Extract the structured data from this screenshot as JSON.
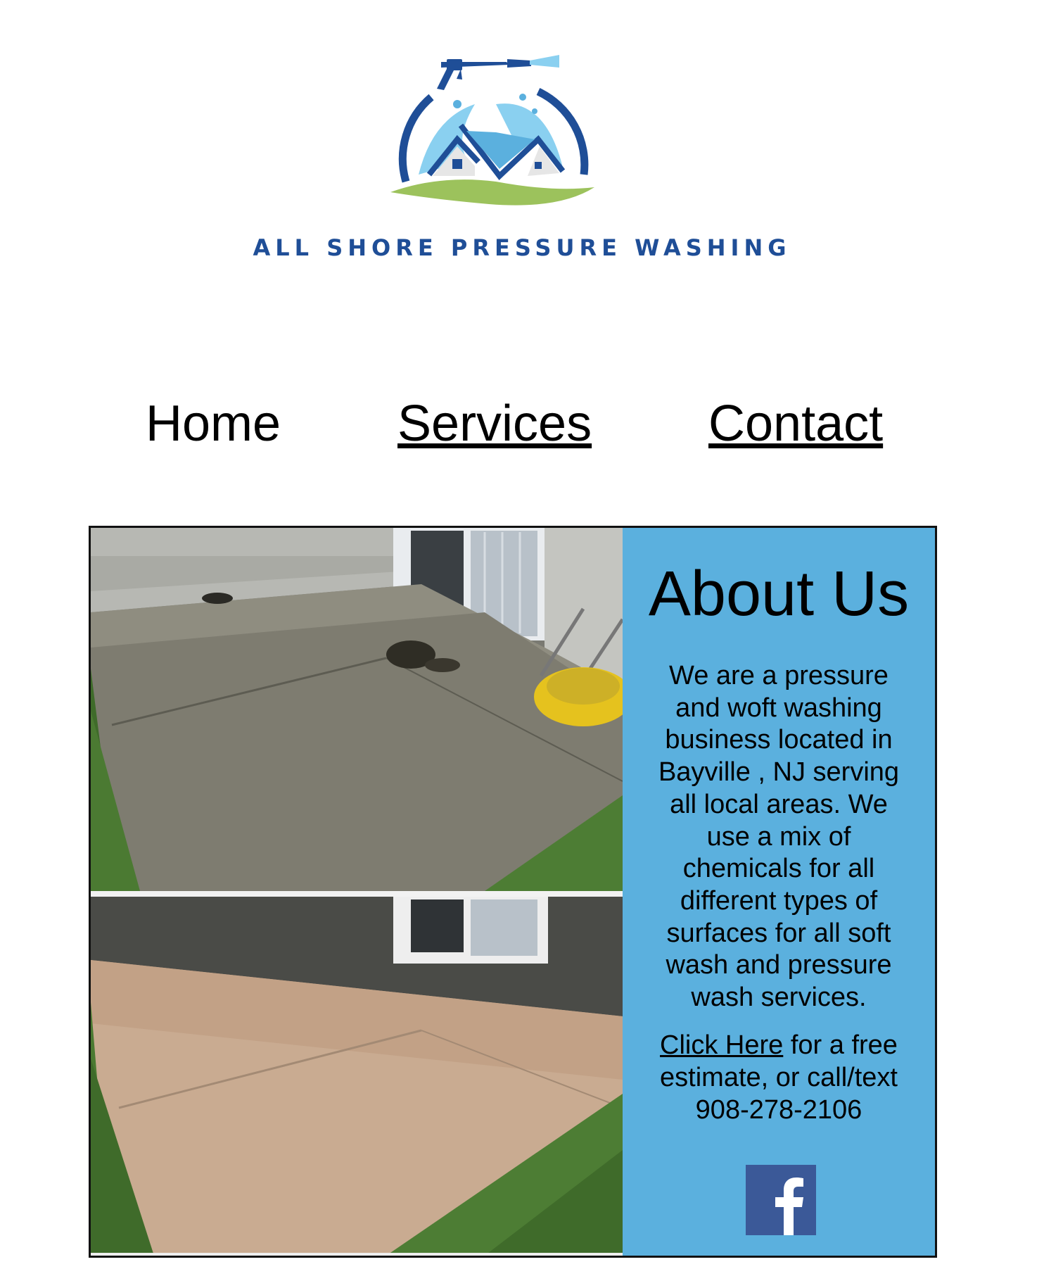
{
  "brand": {
    "name": "ALL SHORE PRESSURE WASHING",
    "colors": {
      "navy": "#1f4e97",
      "sky": "#5bb0de",
      "light_blue": "#8ad0f0",
      "grass": "#9cc25c"
    }
  },
  "nav": {
    "home": "Home",
    "services": "Services",
    "contact": "Contact"
  },
  "about": {
    "title": "About Us",
    "body": "We are a pressure and woft washing business located in Bayville , NJ serving all local areas. We use a mix of chemicals for all different types of surfaces for all soft wash and pressure wash services.",
    "cta_link": "Click Here",
    "cta_rest": " for a free estimate, or call/text 908-278-2106",
    "panel_color": "#5bb0de"
  },
  "social": {
    "facebook_icon": "facebook-icon",
    "facebook_color": "#3b5998"
  }
}
